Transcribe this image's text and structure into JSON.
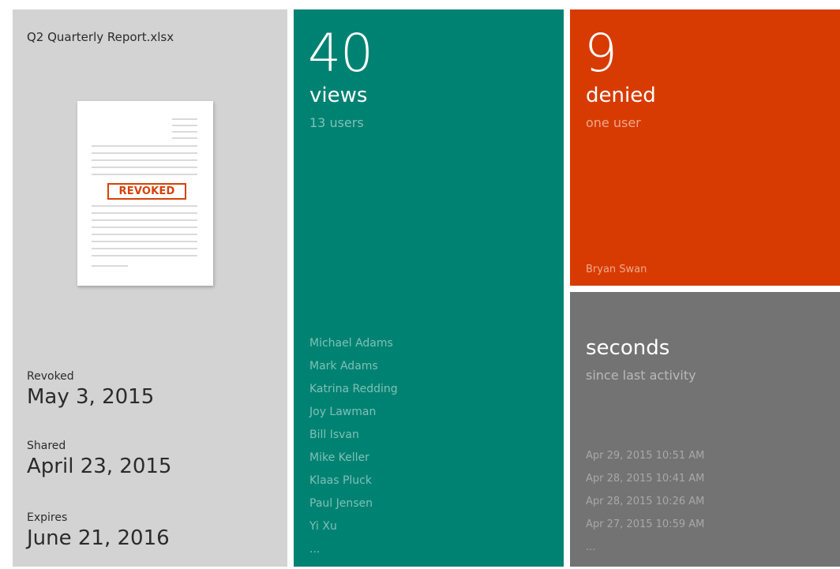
{
  "document": {
    "filename": "Q2 Quarterly Report.xlsx",
    "stamp": "REVOKED",
    "revoked_label": "Revoked",
    "revoked_date": "May 3, 2015",
    "shared_label": "Shared",
    "shared_date": "April 23, 2015",
    "expires_label": "Expires",
    "expires_date": "June 21, 2016"
  },
  "views": {
    "count": "40",
    "label": "views",
    "sub": "13 users",
    "users": [
      "Michael Adams",
      "Mark Adams",
      "Katrina Redding",
      "Joy Lawman",
      "Bill Isvan",
      "Mike Keller",
      "Klaas Pluck",
      "Paul Jensen",
      "Yi Xu",
      "..."
    ]
  },
  "denied": {
    "count": "9",
    "label": "denied",
    "sub": "one user",
    "user": "Bryan Swan"
  },
  "activity": {
    "label": "seconds",
    "sub": "since last activity",
    "entries": [
      "Apr 29, 2015 10:51 AM",
      "Apr 28, 2015 10:41 AM",
      "Apr 28, 2015 10:26 AM",
      "Apr 27, 2015 10:59 AM",
      "..."
    ]
  },
  "colors": {
    "doc_bg": "#d3d3d3",
    "views_bg": "#008272",
    "denied_bg": "#d83b01",
    "activity_bg": "#737373",
    "stamp": "#d74108"
  },
  "icons": {
    "document_thumbnail": "document-revoked-icon"
  }
}
